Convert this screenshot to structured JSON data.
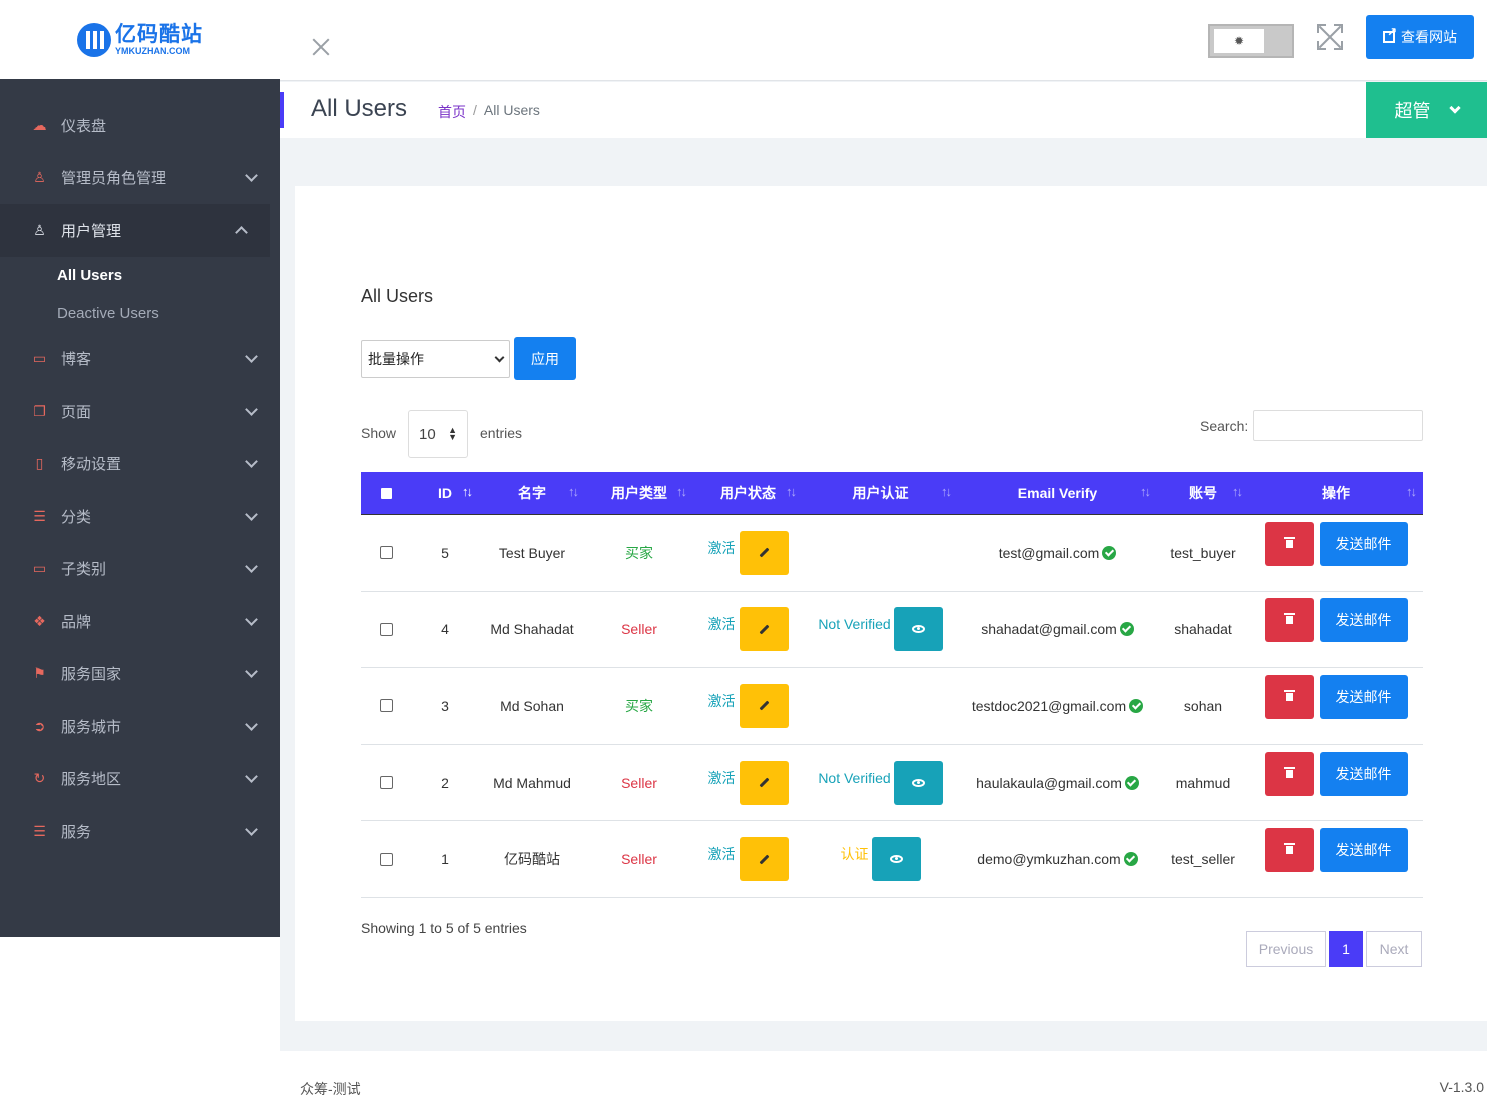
{
  "brand": {
    "name_cn": "亿码酷站",
    "name_en": "YMKUZHAN.COM"
  },
  "sidebar": {
    "items": [
      {
        "label": "仪表盘",
        "icon": "dashboard-icon"
      },
      {
        "label": "管理员角色管理",
        "icon": "user-icon"
      },
      {
        "label": "用户管理",
        "icon": "user-icon",
        "open": true
      },
      {
        "label": "博客",
        "icon": "comment-icon"
      },
      {
        "label": "页面",
        "icon": "page-icon"
      },
      {
        "label": "移动设置",
        "icon": "mobile-icon"
      },
      {
        "label": "分类",
        "icon": "list-icon"
      },
      {
        "label": "子类别",
        "icon": "card-icon"
      },
      {
        "label": "品牌",
        "icon": "brand-icon"
      },
      {
        "label": "服务国家",
        "icon": "flag-icon"
      },
      {
        "label": "服务城市",
        "icon": "circle-arrow-icon"
      },
      {
        "label": "服务地区",
        "icon": "refresh-icon"
      },
      {
        "label": "服务",
        "icon": "list-icon"
      }
    ],
    "sub_items": [
      {
        "label": "All Users",
        "active": true
      },
      {
        "label": "Deactive Users"
      }
    ]
  },
  "topbar": {
    "view_site": "查看网站",
    "theme_toggle_icon": "sun-icon"
  },
  "header": {
    "title": "All Users",
    "breadcrumb_home": "首页",
    "breadcrumb_sep": "/",
    "breadcrumb_current": "All Users",
    "admin_label": "超管"
  },
  "card": {
    "title": "All Users",
    "bulk_select": "批量操作",
    "apply": "应用",
    "show": "Show",
    "length": "10",
    "entries": "entries",
    "search_label": "Search:"
  },
  "table": {
    "columns": [
      "ID",
      "名字",
      "用户类型",
      "用户状态",
      "用户认证",
      "Email Verify",
      "账号",
      "操作"
    ],
    "rows": [
      {
        "id": "5",
        "name": "Test Buyer",
        "type": "买家",
        "type_kind": "buyer",
        "status": "激活",
        "verify": "",
        "email": "test@gmail.com",
        "account": "test_buyer",
        "mail_btn": "发送邮件"
      },
      {
        "id": "4",
        "name": "Md Shahadat",
        "type": "Seller",
        "type_kind": "seller",
        "status": "激活",
        "verify": "Not Verified",
        "email": "shahadat@gmail.com",
        "account": "shahadat",
        "mail_btn": "发送邮件"
      },
      {
        "id": "3",
        "name": "Md Sohan",
        "type": "买家",
        "type_kind": "buyer",
        "status": "激活",
        "verify": "",
        "email": "testdoc2021@gmail.com",
        "account": "sohan",
        "mail_btn": "发送邮件"
      },
      {
        "id": "2",
        "name": "Md Mahmud",
        "type": "Seller",
        "type_kind": "seller",
        "status": "激活",
        "verify": "Not Verified",
        "email": "haulakaula@gmail.com",
        "account": "mahmud",
        "mail_btn": "发送邮件"
      },
      {
        "id": "1",
        "name": "亿码酷站",
        "type": "Seller",
        "type_kind": "seller",
        "status": "激活",
        "verify": "认证",
        "email": "demo@ymkuzhan.com",
        "account": "test_seller",
        "mail_btn": "发送邮件"
      }
    ]
  },
  "info": "Showing 1 to 5 of 5 entries",
  "pager": {
    "previous": "Previous",
    "current": "1",
    "next": "Next"
  },
  "footer": {
    "left": "众筹-测试",
    "right": "V-1.3.0"
  },
  "colors": {
    "primary": "#4a3cf7",
    "blue": "#1480f0",
    "green": "#1fbf8f",
    "sidebar": "#343a46",
    "danger": "#dc3545",
    "warning": "#ffc107",
    "info": "#17a2b8"
  }
}
